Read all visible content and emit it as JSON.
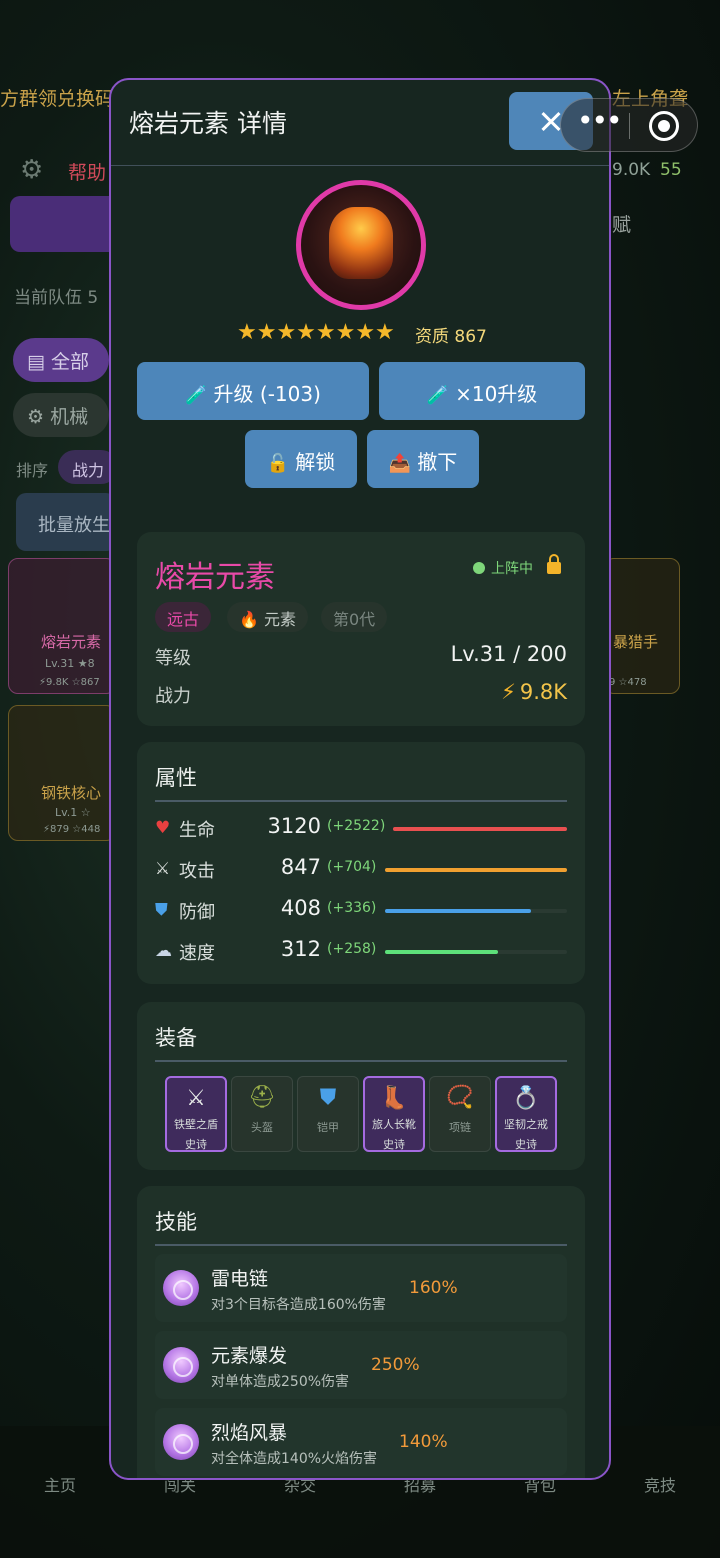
{
  "background": {
    "top_left_text": "方群领兑换码",
    "top_right_text": "左上角聋",
    "help": "帮助",
    "res_power": "9.0K",
    "res_potion": "55",
    "talent_tab": "赋",
    "team_label": "当前队伍 5",
    "filter_all": "全部",
    "filter_mech": "机械",
    "sort_label": "排序",
    "sort_value": "战力",
    "batch_button": "批量放生",
    "cards": [
      {
        "name": "熔岩元素",
        "level": "Lv.31 ★8",
        "stats": "⚡9.8K ☆867",
        "badge": "阵"
      },
      {
        "name": "钢铁核心",
        "level": "Lv.1 ☆",
        "stats": "⚡879 ☆448"
      },
      {
        "name": "暴猎手",
        "level": "1 ☆",
        "stats": "9 ☆478"
      }
    ],
    "nav": [
      "主页",
      "闯关",
      "杂交",
      "招募",
      "背包",
      "竞技"
    ]
  },
  "modal": {
    "title": "熔岩元素 详情",
    "stars": "★★★★★★★★",
    "quality": "资质 867",
    "buttons": {
      "upgrade": "升级 (-103)",
      "upgrade10": "×10升级",
      "unlock": "解锁",
      "remove": "撤下"
    },
    "info": {
      "name": "熔岩元素",
      "status": "上阵中",
      "tags": [
        "远古",
        "元素",
        "第0代"
      ],
      "level_label": "等级",
      "level_value": "Lv.31 / 200",
      "power_label": "战力",
      "power_value": "9.8K"
    },
    "attributes": {
      "title": "属性",
      "rows": [
        {
          "icon": "heart-icon",
          "label": "生命",
          "value": "3120",
          "bonus": "(+2522)",
          "color": "#e85050",
          "fill": 1.0
        },
        {
          "icon": "swords-icon",
          "label": "攻击",
          "value": "847",
          "bonus": "(+704)",
          "color": "#f0a030",
          "fill": 1.0
        },
        {
          "icon": "shield-icon",
          "label": "防御",
          "value": "408",
          "bonus": "(+336)",
          "color": "#4aa0e8",
          "fill": 0.8
        },
        {
          "icon": "wind-icon",
          "label": "速度",
          "value": "312",
          "bonus": "(+258)",
          "color": "#5de07a",
          "fill": 0.62
        }
      ]
    },
    "equipment": {
      "title": "装备",
      "slots": [
        {
          "name": "铁壁之盾",
          "tier": "史诗",
          "icon": "swords-icon",
          "epic": true
        },
        {
          "name": "头盔",
          "icon": "helmet-icon",
          "epic": false
        },
        {
          "name": "铠甲",
          "icon": "armor-icon",
          "epic": false
        },
        {
          "name": "旅人长靴",
          "tier": "史诗",
          "icon": "boot-icon",
          "epic": true
        },
        {
          "name": "项链",
          "icon": "necklace-icon",
          "epic": false
        },
        {
          "name": "坚韧之戒",
          "tier": "史诗",
          "icon": "ring-icon",
          "epic": true
        }
      ]
    },
    "skills": {
      "title": "技能",
      "items": [
        {
          "name": "雷电链",
          "desc": "对3个目标各造成160%伤害",
          "pct": "160%"
        },
        {
          "name": "元素爆发",
          "desc": "对单体造成250%伤害",
          "pct": "250%"
        },
        {
          "name": "烈焰风暴",
          "desc": "对全体造成140%火焰伤害",
          "pct": "140%"
        }
      ]
    }
  }
}
